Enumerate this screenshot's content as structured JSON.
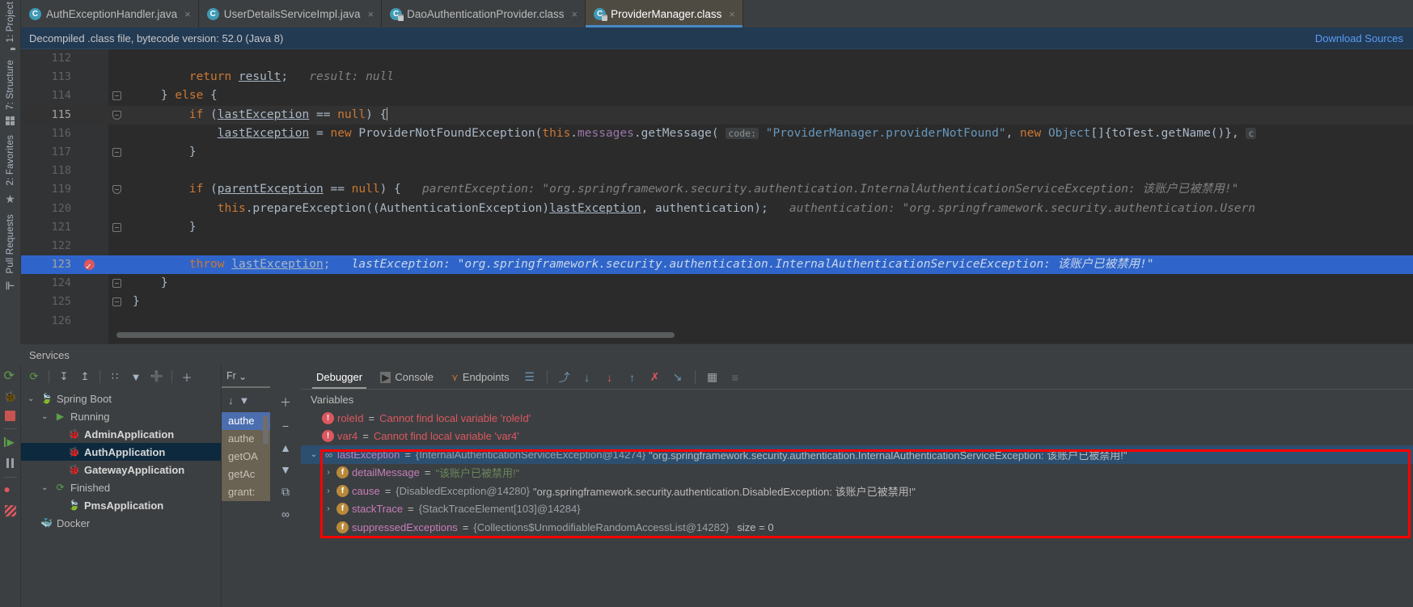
{
  "left_strip": {
    "tabs": [
      {
        "label": "1: Project",
        "icon": "folder-icon"
      },
      {
        "label": "7: Structure",
        "icon": "structure-grid-icon"
      },
      {
        "label": "2: Favorites",
        "icon": "star-icon"
      },
      {
        "label": "Pull Requests",
        "icon": "pull-request-icon"
      }
    ]
  },
  "editor_tabs": [
    {
      "label": "AuthExceptionHandler.java",
      "icon": "java-class-icon",
      "active": false,
      "close": "×"
    },
    {
      "label": "UserDetailsServiceImpl.java",
      "icon": "java-class-icon",
      "active": false,
      "close": "×"
    },
    {
      "label": "DaoAuthenticationProvider.class",
      "icon": "java-class-locked-icon",
      "active": false,
      "close": "×"
    },
    {
      "label": "ProviderManager.class",
      "icon": "java-class-locked-icon",
      "active": true,
      "close": "×"
    }
  ],
  "banner": {
    "text": "Decompiled .class file, bytecode version: 52.0 (Java 8)",
    "download_label": "Download Sources"
  },
  "editor": {
    "lines": [
      {
        "num": "112",
        "fold": "",
        "bp": false,
        "hl": false,
        "cur": false,
        "segs": []
      },
      {
        "num": "113",
        "fold": "",
        "bp": false,
        "hl": false,
        "cur": false,
        "segs": [
          {
            "t": "        ",
            "c": "id"
          },
          {
            "t": "return ",
            "c": "k"
          },
          {
            "t": "result",
            "c": "id u"
          },
          {
            "t": ";",
            "c": "id"
          },
          {
            "t": "   result: null",
            "c": "hint"
          }
        ]
      },
      {
        "num": "114",
        "fold": "up",
        "bp": false,
        "hl": false,
        "cur": false,
        "segs": [
          {
            "t": "    } ",
            "c": "id"
          },
          {
            "t": "else",
            "c": "k"
          },
          {
            "t": " {",
            "c": "id"
          }
        ]
      },
      {
        "num": "115",
        "fold": "down",
        "bp": false,
        "hl": false,
        "cur": true,
        "segs": [
          {
            "t": "        ",
            "c": "id"
          },
          {
            "t": "if",
            "c": "k"
          },
          {
            "t": " (",
            "c": "id"
          },
          {
            "t": "lastException",
            "c": "id u"
          },
          {
            "t": " == ",
            "c": "id"
          },
          {
            "t": "null",
            "c": "k"
          },
          {
            "t": ") {",
            "c": "id"
          },
          {
            "t": "|",
            "c": "caret"
          }
        ]
      },
      {
        "num": "116",
        "fold": "",
        "bp": false,
        "hl": false,
        "cur": false,
        "segs": [
          {
            "t": "            ",
            "c": "id"
          },
          {
            "t": "lastException",
            "c": "id u"
          },
          {
            "t": " = ",
            "c": "id"
          },
          {
            "t": "new",
            "c": "k"
          },
          {
            "t": " ProviderNotFoundException(",
            "c": "id"
          },
          {
            "t": "this",
            "c": "k"
          },
          {
            "t": ".",
            "c": "id"
          },
          {
            "t": "messages",
            "c": "fld"
          },
          {
            "t": ".getMessage( ",
            "c": "id"
          },
          {
            "t": "code:",
            "c": "param"
          },
          {
            "t": " ",
            "c": "id"
          },
          {
            "t": "\"ProviderManager.providerNotFound\"",
            "c": "st"
          },
          {
            "t": ", ",
            "c": "id"
          },
          {
            "t": "new",
            "c": "k"
          },
          {
            "t": " ",
            "c": "id"
          },
          {
            "t": "Object",
            "c": "st"
          },
          {
            "t": "[]{toTest.getName()}, ",
            "c": "id"
          },
          {
            "t": "c",
            "c": "param"
          }
        ]
      },
      {
        "num": "117",
        "fold": "up",
        "bp": false,
        "hl": false,
        "cur": false,
        "segs": [
          {
            "t": "        }",
            "c": "id"
          }
        ]
      },
      {
        "num": "118",
        "fold": "",
        "bp": false,
        "hl": false,
        "cur": false,
        "segs": []
      },
      {
        "num": "119",
        "fold": "down",
        "bp": false,
        "hl": false,
        "cur": false,
        "segs": [
          {
            "t": "        ",
            "c": "id"
          },
          {
            "t": "if",
            "c": "k"
          },
          {
            "t": " (",
            "c": "id"
          },
          {
            "t": "parentException",
            "c": "id u"
          },
          {
            "t": " == ",
            "c": "id"
          },
          {
            "t": "null",
            "c": "k"
          },
          {
            "t": ") {",
            "c": "id"
          },
          {
            "t": "   parentException: \"org.springframework.security.authentication.InternalAuthenticationServiceException: 该账户已被禁用!\"",
            "c": "hint"
          }
        ]
      },
      {
        "num": "120",
        "fold": "",
        "bp": false,
        "hl": false,
        "cur": false,
        "segs": [
          {
            "t": "            ",
            "c": "id"
          },
          {
            "t": "this",
            "c": "k"
          },
          {
            "t": ".prepareException((AuthenticationException)",
            "c": "id"
          },
          {
            "t": "lastException",
            "c": "id u"
          },
          {
            "t": ", authentication);",
            "c": "id"
          },
          {
            "t": "   authentication: \"org.springframework.security.authentication.Usern",
            "c": "hint"
          }
        ]
      },
      {
        "num": "121",
        "fold": "up",
        "bp": false,
        "hl": false,
        "cur": false,
        "segs": [
          {
            "t": "        }",
            "c": "id"
          }
        ]
      },
      {
        "num": "122",
        "fold": "",
        "bp": false,
        "hl": false,
        "cur": false,
        "segs": []
      },
      {
        "num": "123",
        "fold": "",
        "bp": true,
        "hl": true,
        "cur": false,
        "segs": [
          {
            "t": "        ",
            "c": "id"
          },
          {
            "t": "throw",
            "c": "k"
          },
          {
            "t": " ",
            "c": "id"
          },
          {
            "t": "lastException",
            "c": "id u"
          },
          {
            "t": ";",
            "c": "id"
          },
          {
            "t": "   lastException: \"org.springframework.security.authentication.InternalAuthenticationServiceException: 该账户已被禁用!\"",
            "c": "hint"
          }
        ]
      },
      {
        "num": "124",
        "fold": "up",
        "bp": false,
        "hl": false,
        "cur": false,
        "segs": [
          {
            "t": "    }",
            "c": "id"
          }
        ]
      },
      {
        "num": "125",
        "fold": "up",
        "bp": false,
        "hl": false,
        "cur": false,
        "segs": [
          {
            "t": "}",
            "c": "id"
          }
        ]
      },
      {
        "num": "126",
        "fold": "",
        "bp": false,
        "hl": false,
        "cur": false,
        "segs": []
      }
    ]
  },
  "services": {
    "title": "Services",
    "toolbar": [
      {
        "icon": "rerun-icon",
        "glyph": "⟳"
      },
      {
        "icon": "expand-all-icon",
        "glyph": "↧"
      },
      {
        "icon": "collapse-all-icon",
        "glyph": "↥"
      },
      {
        "icon": "group-by-icon",
        "glyph": "∷"
      },
      {
        "icon": "filter-icon",
        "glyph": "▼"
      },
      {
        "icon": "add-tab-icon",
        "glyph": "➕"
      },
      {
        "icon": "add-service-icon",
        "glyph": "＋"
      }
    ],
    "tree": [
      {
        "label": "Spring Boot",
        "indent": 0,
        "chevron": "⌄",
        "icon": "spring-boot-icon",
        "bold": false,
        "selected": false
      },
      {
        "label": "Running",
        "indent": 1,
        "chevron": "⌄",
        "icon": "run-icon",
        "bold": false,
        "selected": false
      },
      {
        "label": "AdminApplication",
        "indent": 2,
        "chevron": "",
        "icon": "debug-bug-icon",
        "bold": true,
        "selected": false
      },
      {
        "label": "AuthApplication",
        "indent": 2,
        "chevron": "",
        "icon": "debug-bug-icon",
        "bold": true,
        "selected": true
      },
      {
        "label": "GatewayApplication",
        "indent": 2,
        "chevron": "",
        "icon": "debug-bug-icon",
        "bold": true,
        "selected": false
      },
      {
        "label": "Finished",
        "indent": 1,
        "chevron": "⌄",
        "icon": "rerun-icon",
        "bold": false,
        "selected": false
      },
      {
        "label": "PmsApplication",
        "indent": 2,
        "chevron": "",
        "icon": "spring-boot-icon",
        "bold": true,
        "selected": false
      },
      {
        "label": "Docker",
        "indent": 0,
        "chevron": "",
        "icon": "docker-icon",
        "bold": false,
        "selected": false
      }
    ]
  },
  "frames": {
    "header_label": "Fr",
    "header_chevron": "⌄",
    "toolbar": [
      {
        "icon": "thread-dump-icon",
        "glyph": "↓"
      },
      {
        "icon": "filter-frames-icon",
        "glyph": "▼"
      }
    ],
    "items": [
      {
        "label": "authe",
        "state": "selected"
      },
      {
        "label": "authe",
        "state": "marked"
      },
      {
        "label": "getOA",
        "state": "marked"
      },
      {
        "label": "getAc",
        "state": "marked"
      },
      {
        "label": "grant:",
        "state": "marked"
      }
    ]
  },
  "debugger": {
    "tabs": [
      {
        "label": "Debugger",
        "icon": "",
        "active": true
      },
      {
        "label": "Console",
        "icon": "console-icon",
        "active": false
      },
      {
        "label": "Endpoints",
        "icon": "endpoints-icon",
        "active": false
      }
    ],
    "buttons": [
      {
        "icon": "layout-settings-icon",
        "glyph": "☰"
      },
      {
        "icon": "step-over-icon",
        "glyph": "⤴"
      },
      {
        "icon": "step-into-icon",
        "glyph": "↓"
      },
      {
        "icon": "force-step-into-icon",
        "glyph": "↓"
      },
      {
        "icon": "step-out-icon",
        "glyph": "↑"
      },
      {
        "icon": "drop-frame-icon",
        "glyph": "✗"
      },
      {
        "icon": "run-to-cursor-icon",
        "glyph": "↘"
      },
      {
        "icon": "evaluate-expression-icon",
        "glyph": "▦"
      },
      {
        "icon": "show-execution-point-icon",
        "glyph": "≡"
      }
    ]
  },
  "variables": {
    "header": "Variables",
    "toolbar": [
      {
        "icon": "add-watch-icon",
        "glyph": "＋"
      },
      {
        "icon": "remove-watch-icon",
        "glyph": "−"
      },
      {
        "icon": "move-up-icon",
        "glyph": "▲"
      },
      {
        "icon": "move-down-icon",
        "glyph": "▼"
      },
      {
        "icon": "copy-value-icon",
        "glyph": "⧉"
      },
      {
        "icon": "inspect-icon",
        "glyph": "∞"
      }
    ],
    "rows": [
      {
        "chevron": "",
        "icon_type": "err",
        "icon_glyph": "!",
        "name": "roleId",
        "name_class": "errtxt",
        "eq": "=",
        "value": "Cannot find local variable 'roleId'",
        "value_class": "errtxt",
        "ref": "",
        "str": "",
        "size": "",
        "indent": 0,
        "selected": false
      },
      {
        "chevron": "",
        "icon_type": "err",
        "icon_glyph": "!",
        "name": "var4",
        "name_class": "errtxt",
        "eq": "=",
        "value": "Cannot find local variable 'var4'",
        "value_class": "errtxt",
        "ref": "",
        "str": "",
        "size": "",
        "indent": 0,
        "selected": false
      },
      {
        "chevron": "⌄",
        "icon_type": "obj",
        "icon_glyph": "∞",
        "name": "lastException",
        "name_class": "",
        "eq": "=",
        "value": "",
        "value_class": "",
        "ref": "{InternalAuthenticationServiceException@14274}",
        "str": "\"org.springframework.security.authentication.InternalAuthenticationServiceException: 该账户已被禁用!\"",
        "str_class": "plain",
        "size": "",
        "indent": 0,
        "selected": true
      },
      {
        "chevron": "›",
        "icon_type": "fld",
        "icon_glyph": "f",
        "name": "detailMessage",
        "name_class": "",
        "eq": "=",
        "value": "",
        "value_class": "",
        "ref": "",
        "str": "\"该账户已被禁用!\"",
        "str_class": "green",
        "size": "",
        "indent": 1,
        "selected": false
      },
      {
        "chevron": "›",
        "icon_type": "fld",
        "icon_glyph": "f",
        "name": "cause",
        "name_class": "",
        "eq": "=",
        "value": "",
        "value_class": "",
        "ref": "{DisabledException@14280}",
        "str": "\"org.springframework.security.authentication.DisabledException: 该账户已被禁用!\"",
        "str_class": "plain",
        "size": "",
        "indent": 1,
        "selected": false
      },
      {
        "chevron": "›",
        "icon_type": "fld",
        "icon_glyph": "f",
        "name": "stackTrace",
        "name_class": "",
        "eq": "=",
        "value": "",
        "value_class": "",
        "ref": "{StackTraceElement[103]@14284}",
        "str": "",
        "size": "",
        "indent": 1,
        "selected": false
      },
      {
        "chevron": "",
        "icon_type": "fld",
        "icon_glyph": "f",
        "name": "suppressedExceptions",
        "name_class": "",
        "eq": "=",
        "value": "",
        "value_class": "",
        "ref": "{Collections$UnmodifiableRandomAccessList@14282}",
        "str": "",
        "size": "size = 0",
        "indent": 1,
        "selected": false
      }
    ]
  },
  "colors": {
    "accent_blue": "#4a88c7",
    "link_blue": "#589df6",
    "banner_bg": "#233a53",
    "highlight_row": "#2f65ca",
    "selection_navy": "#2d4f6f",
    "error_red": "#db5860",
    "string_green": "#6a8759",
    "keyword_orange": "#cc7832",
    "annotation_red": "#ff0000"
  }
}
